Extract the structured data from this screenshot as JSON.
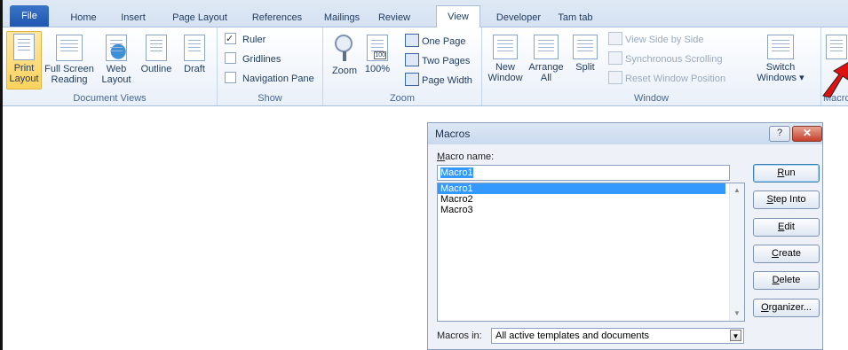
{
  "tabs": [
    "File",
    "Home",
    "Insert",
    "Page Layout",
    "References",
    "Mailings",
    "Review",
    "View",
    "Developer",
    "Tam tab"
  ],
  "active_tab": "View",
  "ribbon": {
    "document_views": {
      "label": "Document Views",
      "print_layout": [
        "Print",
        "Layout"
      ],
      "full_screen": [
        "Full Screen",
        "Reading"
      ],
      "web_layout": [
        "Web",
        "Layout"
      ],
      "outline": "Outline",
      "draft": "Draft"
    },
    "show": {
      "label": "Show",
      "ruler": "Ruler",
      "gridlines": "Gridlines",
      "navigation_pane": "Navigation Pane"
    },
    "zoom": {
      "label": "Zoom",
      "zoom": "Zoom",
      "hundred": "100%",
      "hundred_icon": "100",
      "one_page": "One Page",
      "two_pages": "Two Pages",
      "page_width": "Page Width"
    },
    "window": {
      "label": "Window",
      "new_window": [
        "New",
        "Window"
      ],
      "arrange_all": [
        "Arrange",
        "All"
      ],
      "split": "Split",
      "view_side": "View Side by Side",
      "sync_scroll": "Synchronous Scrolling",
      "reset_pos": "Reset Window Position",
      "switch_windows": [
        "Switch",
        "Windows ▾"
      ]
    },
    "macros": {
      "label": "Macro"
    }
  },
  "dialog": {
    "title": "Macros",
    "help": "?",
    "macro_name_label": "acro name:",
    "macro_name_label_u": "M",
    "macro_name_value": "Macro1",
    "macros": [
      "Macro1",
      "Macro2",
      "Macro3"
    ],
    "buttons": {
      "run": {
        "u": "R",
        "rest": "un"
      },
      "step_into": {
        "u": "S",
        "rest": "tep Into"
      },
      "edit": {
        "u": "E",
        "rest": "dit"
      },
      "create": {
        "u": "C",
        "rest": "reate"
      },
      "delete": {
        "u": "D",
        "rest": "elete"
      },
      "organizer": {
        "u": "O",
        "rest": "rganizer..."
      }
    },
    "macros_in_label_u": "A",
    "macros_in_label": "Macros in:",
    "macros_in_value": "All active templates and documents"
  },
  "colors": {
    "accent": "#2057b2",
    "selection": "#3399ff",
    "arrow": "#e01010"
  }
}
